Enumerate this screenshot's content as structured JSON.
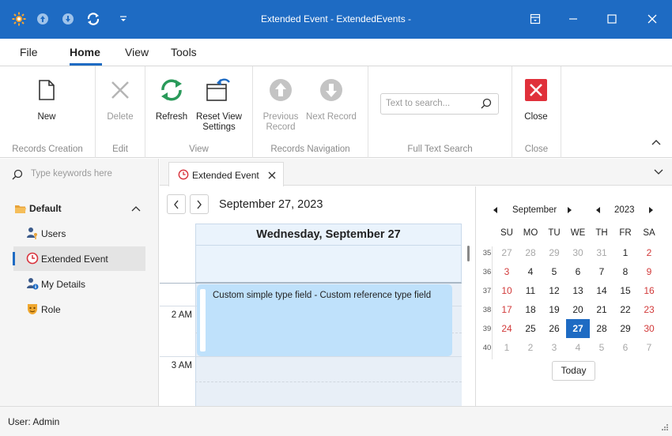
{
  "window": {
    "title": "Extended Event - ExtendedEvents -",
    "accent": "#1e6bc3"
  },
  "quick_access": [
    "app-icon",
    "arrow-up-circle-icon",
    "arrow-down-circle-icon",
    "refresh-icon",
    "customize-icon"
  ],
  "menu": {
    "tabs": [
      {
        "label": "File"
      },
      {
        "label": "Home"
      },
      {
        "label": "View"
      },
      {
        "label": "Tools"
      }
    ],
    "active": "Home"
  },
  "ribbon": {
    "groups": [
      {
        "label": "Records Creation",
        "buttons": [
          {
            "label": "New",
            "icon": "new-document-icon",
            "enabled": true
          }
        ]
      },
      {
        "label": "Edit",
        "buttons": [
          {
            "label": "Delete",
            "icon": "delete-x-icon",
            "enabled": false
          }
        ]
      },
      {
        "label": "View",
        "buttons": [
          {
            "label": "Refresh",
            "icon": "refresh-icon",
            "enabled": true
          },
          {
            "label": "Reset View Settings",
            "icon": "reset-view-icon",
            "enabled": true
          }
        ]
      },
      {
        "label": "Records Navigation",
        "buttons": [
          {
            "label": "Previous Record",
            "icon": "arrow-up-circle-icon",
            "enabled": false
          },
          {
            "label": "Next Record",
            "icon": "arrow-down-circle-icon",
            "enabled": false
          }
        ]
      },
      {
        "label": "Full Text Search",
        "search_placeholder": "Text to search..."
      },
      {
        "label": "Close",
        "buttons": [
          {
            "label": "Close",
            "icon": "close-red-icon",
            "enabled": true
          }
        ]
      }
    ]
  },
  "nav": {
    "search_placeholder": "Type keywords here",
    "group": "Default",
    "items": [
      {
        "label": "Users",
        "icon": "user-key-icon",
        "selected": false
      },
      {
        "label": "Extended Event",
        "icon": "clock-icon",
        "selected": true
      },
      {
        "label": "My Details",
        "icon": "user-info-icon",
        "selected": false
      },
      {
        "label": "Role",
        "icon": "role-mask-icon",
        "selected": false
      }
    ]
  },
  "doc_tab": {
    "label": "Extended Event"
  },
  "scheduler": {
    "date": "September 27, 2023",
    "day_header": "Wednesday, September 27",
    "time_labels": [
      "2 AM",
      "3 AM"
    ],
    "appointment": "Custom simple type field - Custom reference type field"
  },
  "calendar": {
    "month": "September",
    "year": "2023",
    "weekdays": [
      "SU",
      "MO",
      "TU",
      "WE",
      "TH",
      "FR",
      "SA"
    ],
    "weeks": [
      {
        "num": "35",
        "days": [
          "27",
          "28",
          "29",
          "30",
          "31",
          "1",
          "2"
        ]
      },
      {
        "num": "36",
        "days": [
          "3",
          "4",
          "5",
          "6",
          "7",
          "8",
          "9"
        ]
      },
      {
        "num": "37",
        "days": [
          "10",
          "11",
          "12",
          "13",
          "14",
          "15",
          "16"
        ]
      },
      {
        "num": "38",
        "days": [
          "17",
          "18",
          "19",
          "20",
          "21",
          "22",
          "23"
        ]
      },
      {
        "num": "39",
        "days": [
          "24",
          "25",
          "26",
          "27",
          "28",
          "29",
          "30"
        ]
      },
      {
        "num": "40",
        "days": [
          "1",
          "2",
          "3",
          "4",
          "5",
          "6",
          "7"
        ]
      }
    ],
    "selected_day": "27",
    "today_label": "Today"
  },
  "status": {
    "text": "User: Admin"
  }
}
